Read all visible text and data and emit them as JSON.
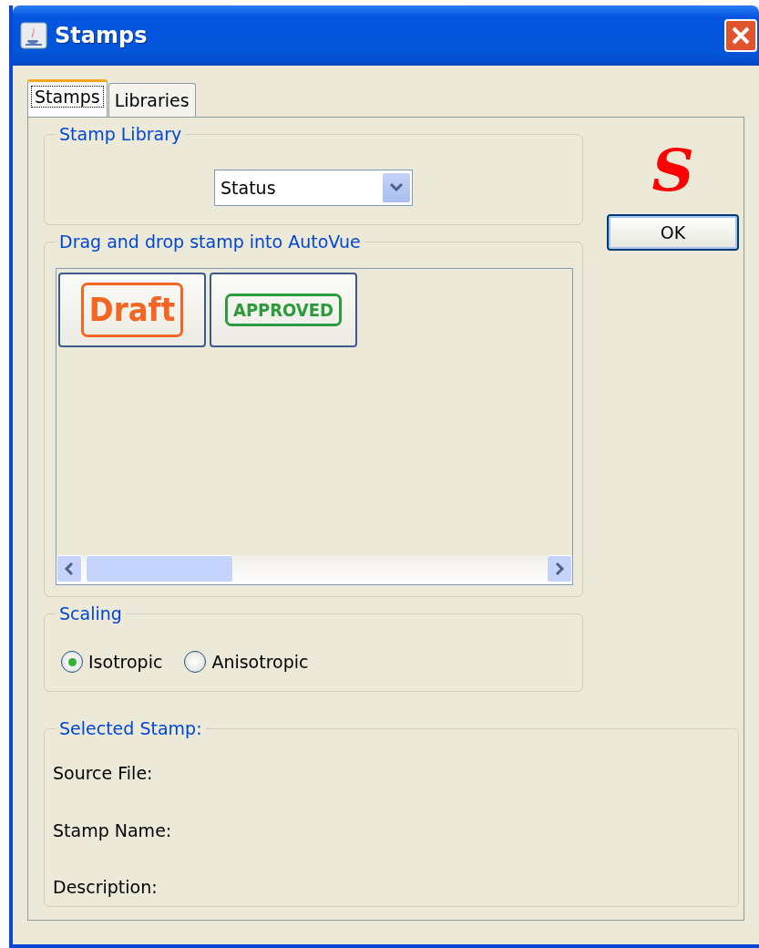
{
  "window": {
    "title": "Stamps"
  },
  "tabs": [
    {
      "label": "Stamps",
      "selected": true
    },
    {
      "label": "Libraries",
      "selected": false
    }
  ],
  "logo": "S",
  "ok_button": "OK",
  "stamp_library": {
    "title": "Stamp Library",
    "value": "Status"
  },
  "stamps_panel": {
    "title": "Drag and drop stamp into AutoVue",
    "stamps": [
      {
        "label": "Draft",
        "color": "#f26522"
      },
      {
        "label": "APPROVED",
        "color": "#2e9a3e"
      }
    ]
  },
  "scaling": {
    "title": "Scaling",
    "options": [
      {
        "label": "Isotropic",
        "selected": true
      },
      {
        "label": "Anisotropic",
        "selected": false
      }
    ]
  },
  "selected_stamp": {
    "title": "Selected Stamp:",
    "fields": [
      {
        "label": "Source File:"
      },
      {
        "label": "Stamp Name:"
      },
      {
        "label": "Description:"
      }
    ]
  }
}
